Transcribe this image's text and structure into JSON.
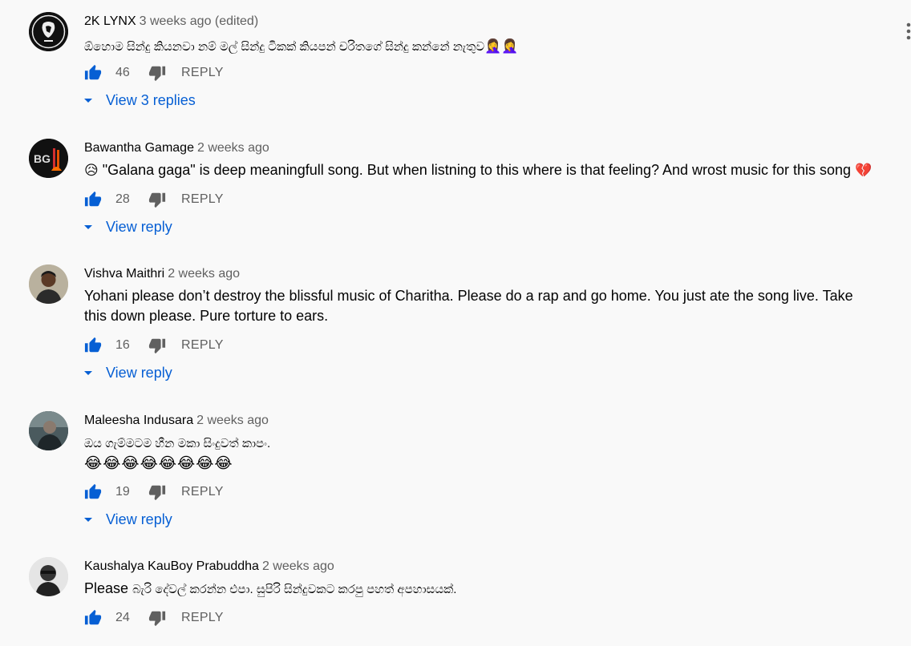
{
  "comments": [
    {
      "author": "2K LYNX",
      "time": "3 weeks ago (edited)",
      "text": "ඕහොම සින්දු කියනවා නම් මල් සින්දු ටිකක් කියපන් චරිතගේ සින්දු කන්නේ නැතුව",
      "emoji": "🤦‍♀️🤦‍♀️",
      "likes": "46",
      "reply_label": "REPLY",
      "view_replies": "View 3 replies",
      "avatar_icon": "lion-logo-icon"
    },
    {
      "author": "Bawantha Gamage",
      "time": "2 weeks ago",
      "emoji_lead": "😥",
      "text": "\"Galana gaga\" is deep meaningfull song. But when listning to this where is that feeling?  And wrost music for this song",
      "emoji": "💔",
      "likes": "28",
      "reply_label": "REPLY",
      "view_replies": "View reply",
      "avatar_icon": "bg-logo-icon"
    },
    {
      "author": "Vishva Maithri",
      "time": "2 weeks ago",
      "text": "Yohani please don’t destroy the blissful music of Charitha. Please do a rap and go home. You just ate the song live. Take this down please. Pure torture to ears.",
      "likes": "16",
      "reply_label": "REPLY",
      "view_replies": "View reply",
      "avatar_icon": "person-photo-icon"
    },
    {
      "author": "Maleesha Indusara",
      "time": "2 weeks ago",
      "text": "ඔය ගැම්මටම හීන මකා සිංදුවත් කාපං.",
      "emoji": "😂😂😂😂😂😂😂😂",
      "likes": "19",
      "reply_label": "REPLY",
      "view_replies": "View reply",
      "avatar_icon": "person-photo-icon"
    },
    {
      "author": "Kaushalya KauBoy Prabuddha",
      "time": "2 weeks ago",
      "text_lead": "Please",
      "text": "බැරි දේවල් කරන්න එපා. සුපිරි සින්දුවකට කරපු පහත් අපහාසයක්.",
      "likes": "24",
      "reply_label": "REPLY",
      "avatar_icon": "person-photo-icon"
    }
  ],
  "colors": {
    "background": "#f9f9f9",
    "link_blue": "#065fd4",
    "like_blue": "#065fd4",
    "muted": "#606060"
  }
}
